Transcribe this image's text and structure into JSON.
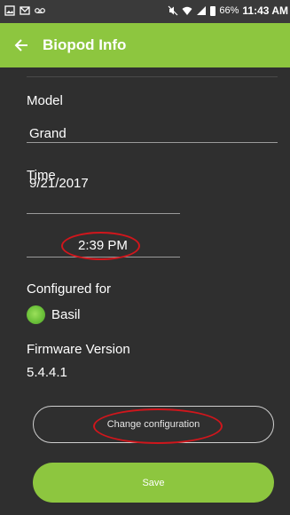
{
  "status_bar": {
    "battery_percent": "66%",
    "time": "11:43 AM"
  },
  "header": {
    "title": "Biopod Info",
    "back_icon": "arrow-left-icon"
  },
  "model": {
    "label": "Model",
    "value": "Grand"
  },
  "time": {
    "label": "Time",
    "date_value": "9/21/2017",
    "time_value": "2:39 PM"
  },
  "configured_for": {
    "label": "Configured for",
    "plant_name": "Basil"
  },
  "firmware": {
    "label": "Firmware Version",
    "value": "5.4.4.1"
  },
  "buttons": {
    "change_configuration": "Change configuration",
    "save": "Save"
  },
  "colors": {
    "accent": "#8dc63f",
    "background": "#2f2f2f",
    "annotation": "#d0161c"
  }
}
